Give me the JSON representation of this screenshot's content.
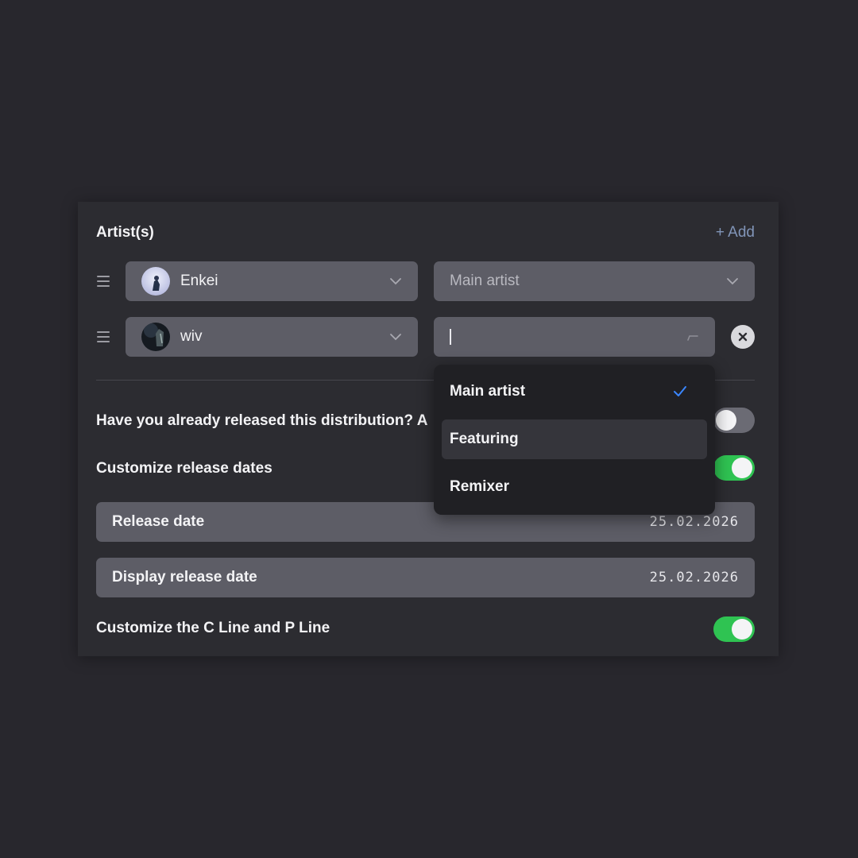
{
  "artists_section": {
    "title": "Artist(s)",
    "add_label": "+ Add",
    "artists": [
      {
        "name": "Enkei",
        "role": "",
        "role_placeholder": "Main artist"
      },
      {
        "name": "wiv",
        "role": "",
        "role_placeholder": ""
      }
    ]
  },
  "role_dropdown": {
    "options": [
      {
        "label": "Main artist",
        "selected": true
      },
      {
        "label": "Featuring",
        "highlighted": true
      },
      {
        "label": "Remixer"
      }
    ]
  },
  "settings": {
    "already_released_label": "Have you already released this distribution? A",
    "already_released_on": false,
    "customize_dates_label": "Customize release dates",
    "customize_dates_on": true,
    "release_date_label": "Release date",
    "release_date_value": "25.02.2026",
    "display_date_label": "Display release date",
    "display_date_value": "25.02.2026",
    "customize_lines_label": "Customize the C Line and P Line",
    "customize_lines_on": true
  },
  "colors": {
    "background": "#28272d",
    "panel": "#2c2c31",
    "field": "#5d5d66",
    "toggle_on": "#2fc352",
    "toggle_off": "#6b6b74",
    "accent_link": "#8195b8",
    "check": "#3a86ff"
  }
}
